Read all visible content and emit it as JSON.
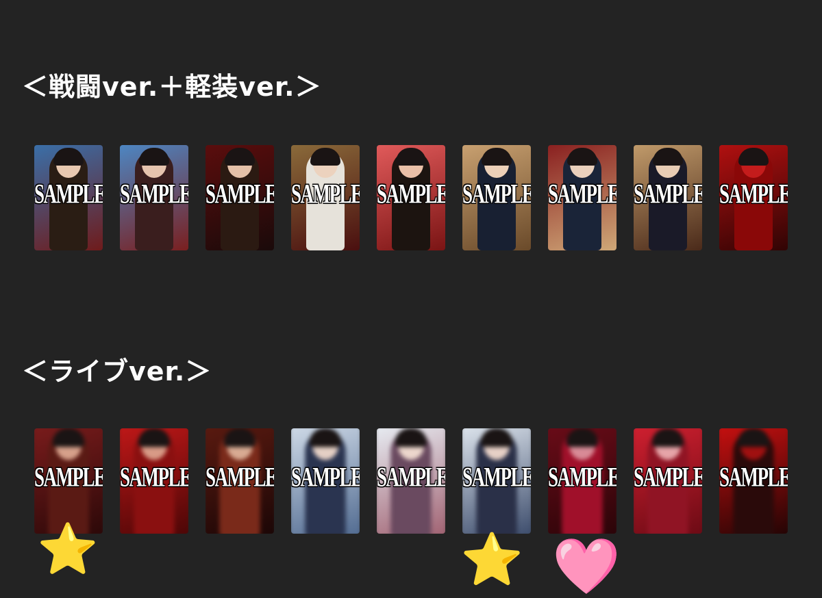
{
  "sections": [
    {
      "title": "＜戦闘ver.＋軽装ver.＞"
    },
    {
      "title": "＜ライブver.＞"
    }
  ],
  "watermark": "SAMPLE",
  "row1_cards": [
    {
      "bg": [
        "#3a6fa8",
        "#6f1b1b"
      ],
      "figure": "#2a1d14",
      "skin": "#e8c8b0"
    },
    {
      "bg": [
        "#4d86c2",
        "#7a1f1f"
      ],
      "figure": "#3a1e1e",
      "skin": "#e6c4ae"
    },
    {
      "bg": [
        "#5a0d0d",
        "#1a0a0a"
      ],
      "figure": "#2b1a12",
      "skin": "#e4c0a8"
    },
    {
      "bg": [
        "#8a6a3a",
        "#4a0f0f"
      ],
      "figure": "#e6e2da",
      "skin": "#ecd2be"
    },
    {
      "bg": [
        "#e05a5a",
        "#7a1414"
      ],
      "figure": "#1c1410",
      "skin": "#eac0a8"
    },
    {
      "bg": [
        "#c8a070",
        "#6a4a2a"
      ],
      "figure": "#182032",
      "skin": "#ecd0b8"
    },
    {
      "bg": [
        "#8a2020",
        "#cfa878"
      ],
      "figure": "#1a2438",
      "skin": "#ead0bc"
    },
    {
      "bg": [
        "#c09a6a",
        "#4a2a1a"
      ],
      "figure": "#1a1a28",
      "skin": "#e8ccb4"
    },
    {
      "bg": [
        "#b01010",
        "#300404"
      ],
      "figure": "#8a0808",
      "skin": "#c41c1c"
    }
  ],
  "row2_cards": [
    {
      "bg": [
        "#7a1c1c",
        "#2a0808"
      ],
      "figure": "#5a1a14",
      "skin": "#d6a08a"
    },
    {
      "bg": [
        "#c01818",
        "#4a0606"
      ],
      "figure": "#8a1010",
      "skin": "#d89a86"
    },
    {
      "bg": [
        "#5a1a10",
        "#1a0606"
      ],
      "figure": "#7a2a1a",
      "skin": "#d8aa92"
    },
    {
      "bg": [
        "#d0dbe8",
        "#506a90"
      ],
      "figure": "#2a3450",
      "skin": "#e4cfc4"
    },
    {
      "bg": [
        "#e8eef4",
        "#a06070"
      ],
      "figure": "#6a4a60",
      "skin": "#ecd6cc"
    },
    {
      "bg": [
        "#dfe6ee",
        "#3a4a6a"
      ],
      "figure": "#2a3048",
      "skin": "#e6d0c6"
    },
    {
      "bg": [
        "#6a0c18",
        "#2a0408"
      ],
      "figure": "#a0102a",
      "skin": "#d88a96"
    },
    {
      "bg": [
        "#d02030",
        "#6a0a14"
      ],
      "figure": "#901424",
      "skin": "#e6a4a8"
    },
    {
      "bg": [
        "#c81010",
        "#200404"
      ],
      "figure": "#2a0a0a",
      "skin": "#a01010"
    }
  ],
  "emojis": [
    {
      "name": "star-emoji-1",
      "char": "⭐"
    },
    {
      "name": "star-emoji-2",
      "char": "⭐"
    },
    {
      "name": "heart-emoji",
      "char": "🩷"
    }
  ]
}
